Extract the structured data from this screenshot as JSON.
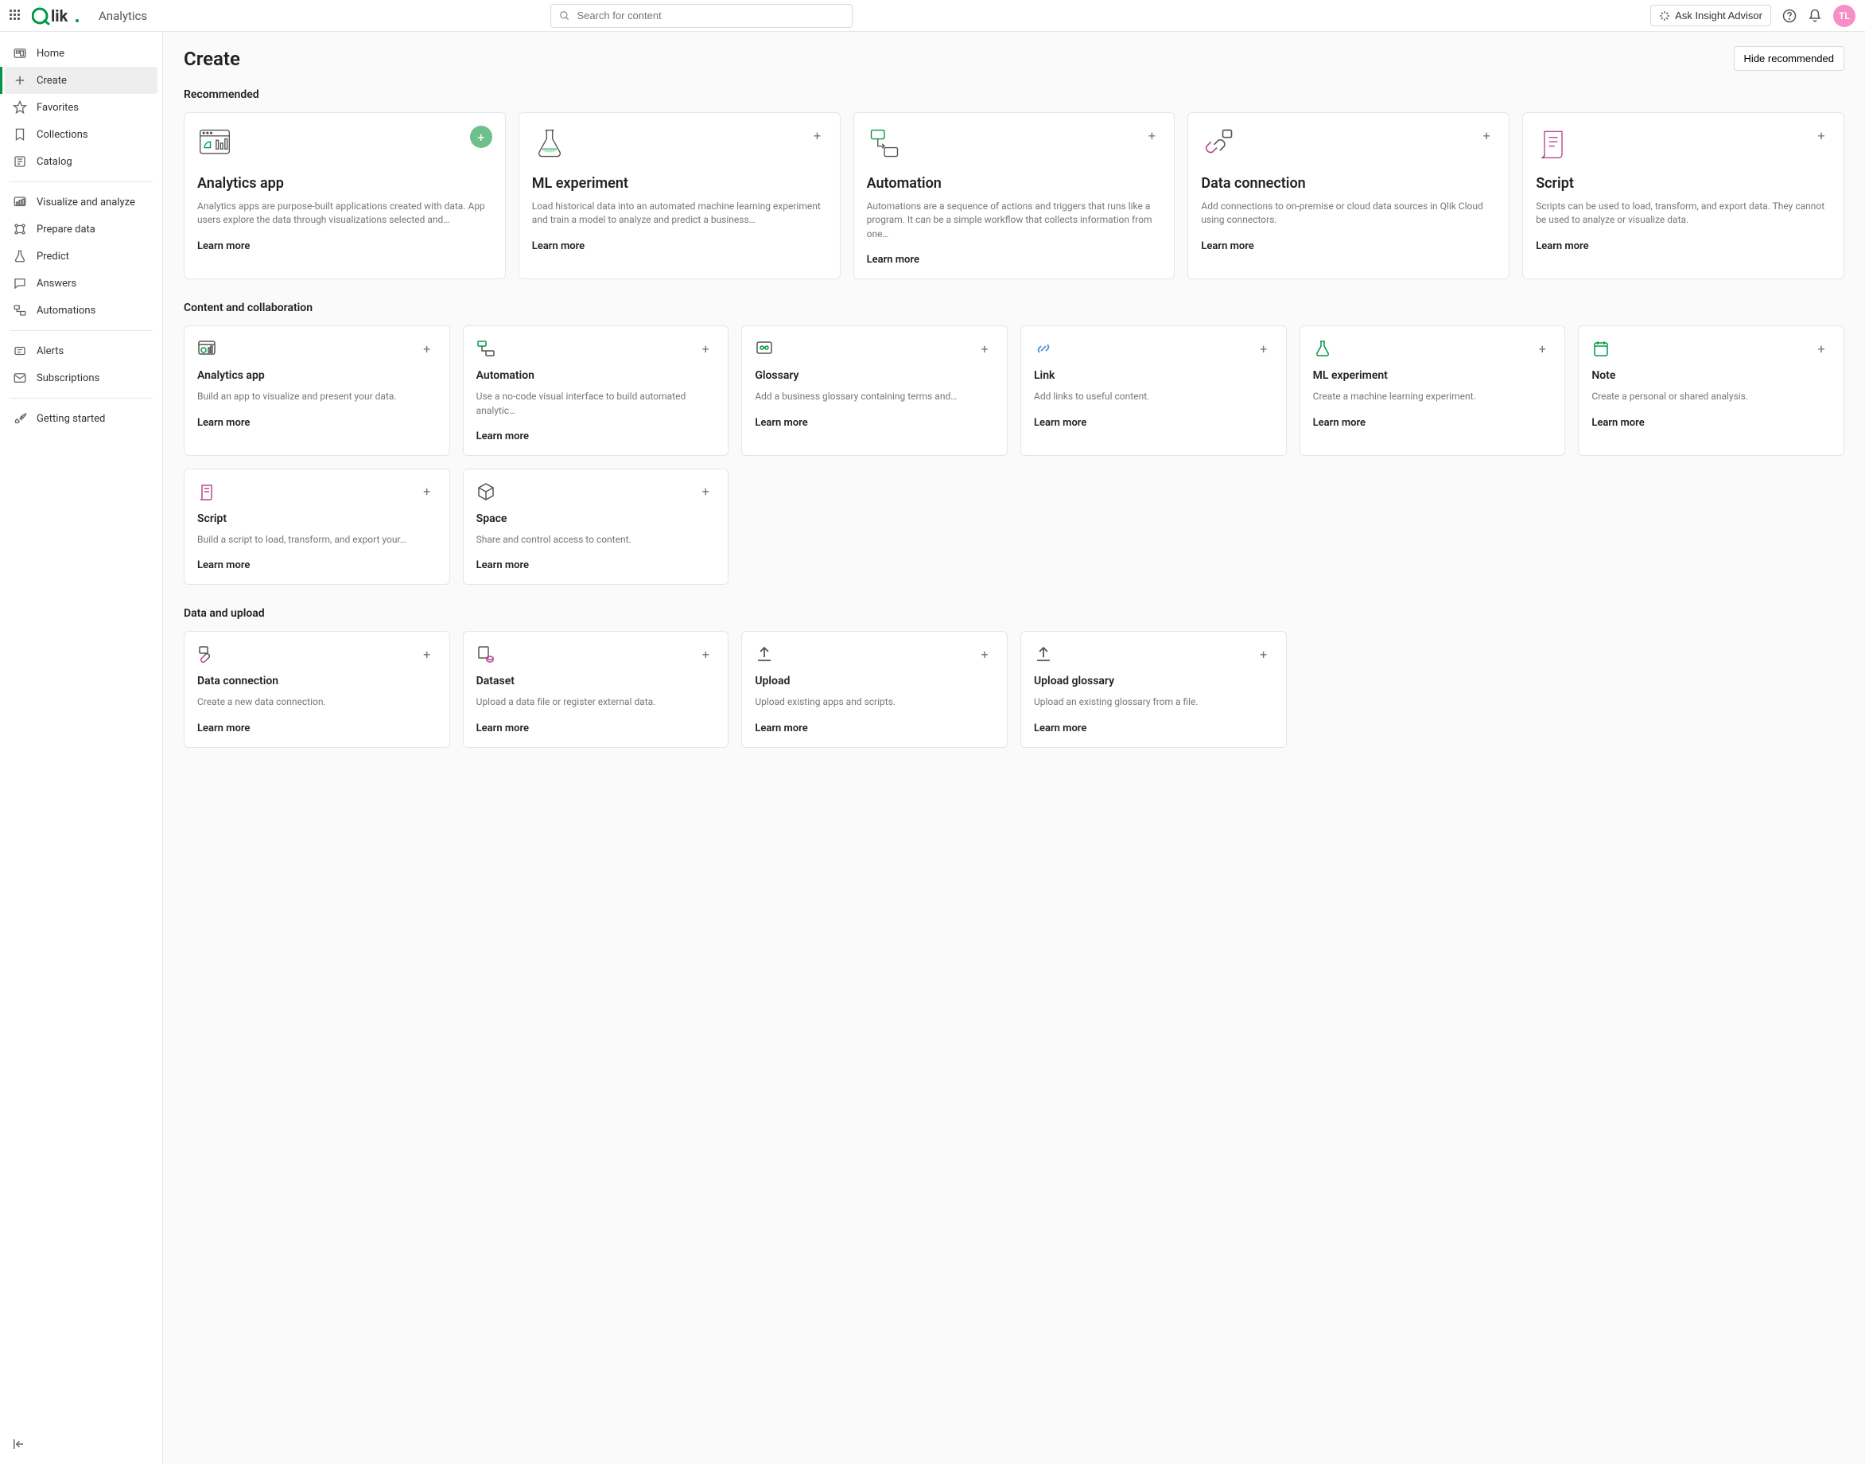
{
  "topbar": {
    "app_name": "Analytics",
    "search_placeholder": "Search for content",
    "insight_label": "Ask Insight Advisor",
    "avatar_initials": "TL"
  },
  "sidebar": {
    "items": {
      "home": "Home",
      "create": "Create",
      "favorites": "Favorites",
      "collections": "Collections",
      "catalog": "Catalog",
      "visualize": "Visualize and analyze",
      "prepare": "Prepare data",
      "predict": "Predict",
      "answers": "Answers",
      "automations": "Automations",
      "alerts": "Alerts",
      "subscriptions": "Subscriptions",
      "getting_started": "Getting started"
    }
  },
  "page": {
    "title": "Create",
    "hide_button": "Hide recommended"
  },
  "sections": {
    "recommended": "Recommended",
    "content": "Content and collaboration",
    "data": "Data and upload"
  },
  "learn_more": "Learn more",
  "recommended": [
    {
      "title": "Analytics app",
      "desc": "Analytics apps are purpose-built applications created with data. App users explore the data through visualizations selected and…"
    },
    {
      "title": "ML experiment",
      "desc": "Load historical data into an automated machine learning experiment and train a model to analyze and predict a business…"
    },
    {
      "title": "Automation",
      "desc": "Automations are a sequence of actions and triggers that runs like a program. It can be a simple workflow that collects information from one…"
    },
    {
      "title": "Data connection",
      "desc": "Add connections to on-premise or cloud data sources in Qlik Cloud using connectors."
    },
    {
      "title": "Script",
      "desc": "Scripts can be used to load, transform, and export data. They cannot be used to analyze or visualize data."
    }
  ],
  "content": [
    {
      "title": "Analytics app",
      "desc": "Build an app to visualize and present your data."
    },
    {
      "title": "Automation",
      "desc": "Use a no-code visual interface to build automated analytic…"
    },
    {
      "title": "Glossary",
      "desc": "Add a business glossary containing terms and…"
    },
    {
      "title": "Link",
      "desc": "Add links to useful content."
    },
    {
      "title": "ML experiment",
      "desc": "Create a machine learning experiment."
    },
    {
      "title": "Note",
      "desc": "Create a personal or shared analysis."
    },
    {
      "title": "Script",
      "desc": "Build a script to load, transform, and export your…"
    },
    {
      "title": "Space",
      "desc": "Share and control access to content."
    }
  ],
  "data": [
    {
      "title": "Data connection",
      "desc": "Create a new data connection."
    },
    {
      "title": "Dataset",
      "desc": "Upload a data file or register external data."
    },
    {
      "title": "Upload",
      "desc": "Upload existing apps and scripts."
    },
    {
      "title": "Upload glossary",
      "desc": "Upload an existing glossary from a file."
    }
  ]
}
